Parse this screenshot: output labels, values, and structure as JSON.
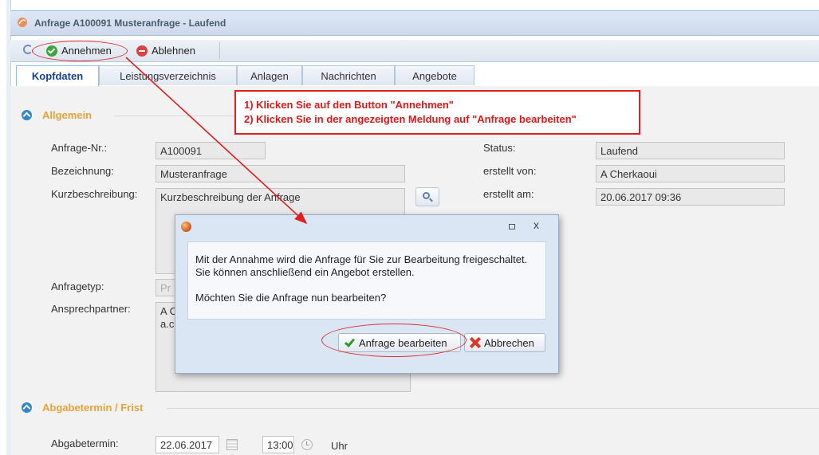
{
  "window": {
    "title": "Anfrage A100091 Musteranfrage - Laufend"
  },
  "toolbar": {
    "accept_label": "Annehmen",
    "reject_label": "Ablehnen"
  },
  "tabs": [
    {
      "label": "Kopfdaten",
      "active": true
    },
    {
      "label": "Leistungsverzeichnis"
    },
    {
      "label": "Anlagen"
    },
    {
      "label": "Nachrichten"
    },
    {
      "label": "Angebote"
    }
  ],
  "sections": {
    "general": "Allgemein",
    "deadline": "Abgabetermin / Frist"
  },
  "fields": {
    "request_no_label": "Anfrage-Nr.:",
    "request_no_value": "A100091",
    "designation_label": "Bezeichnung:",
    "designation_value": "Musteranfrage",
    "short_desc_label": "Kurzbeschreibung:",
    "short_desc_value": "Kurzbeschreibung der Anfrage",
    "status_label": "Status:",
    "status_value": "Laufend",
    "created_by_label": "erstellt von:",
    "created_by_value": "A Cherkaoui",
    "created_at_label": "erstellt am:",
    "created_at_value": "20.06.2017 09:36",
    "request_type_label": "Anfragetyp:",
    "request_type_value": "Pr",
    "contact_label": "Ansprechpartner:",
    "contact_line1": "A C",
    "contact_line2": "a.c",
    "deadline_label": "Abgabetermin:",
    "deadline_date": "22.06.2017",
    "deadline_time": "13:00",
    "deadline_unit": "Uhr"
  },
  "annotation": {
    "line1": "1) Klicken Sie auf den Button \"Annehmen\"",
    "line2": "2) Klicken Sie in der angezeigten Meldung auf \"Anfrage bearbeiten\""
  },
  "dialog": {
    "line1": "Mit der Annahme wird die Anfrage für Sie zur Bearbeitung freigeschaltet.",
    "line2": "Sie können anschließend ein Angebot erstellen.",
    "line3": "Möchten Sie die Anfrage nun bearbeiten?",
    "confirm_label": "Anfrage bearbeiten",
    "cancel_label": "Abbrechen",
    "close_glyph": "x"
  },
  "colors": {
    "annotation_red": "#e02020",
    "section_orange": "#e8a23c",
    "accent_blue": "#15428b"
  }
}
